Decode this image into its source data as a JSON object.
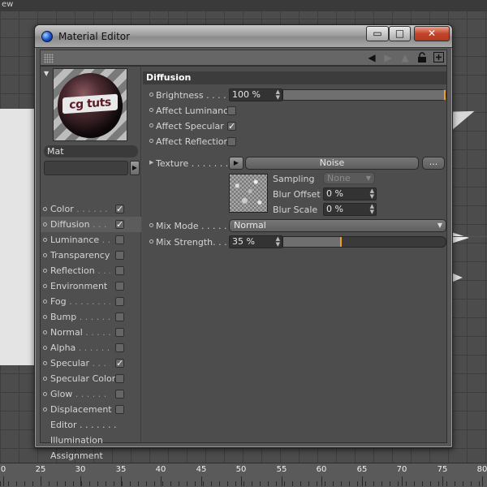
{
  "viewport": {
    "top_text": "ew",
    "ruler_ticks": [
      "0",
      "25",
      "30",
      "35",
      "40",
      "45",
      "50",
      "55",
      "60",
      "65",
      "70",
      "75",
      "80"
    ]
  },
  "window": {
    "title": "Material Editor",
    "buttons": {
      "minimize": "▭",
      "maximize": "□",
      "close": "✕"
    }
  },
  "toolbar": {
    "icons": [
      "grip-icon",
      "arrow-left-icon",
      "arrow-right-icon",
      "arrow-up-icon",
      "lock-icon",
      "new-window-icon"
    ]
  },
  "material": {
    "preview_label": "cg tuts",
    "name": "Mat"
  },
  "channels": [
    {
      "label": "Color",
      "lead": "Color . . . . . . .",
      "checked": true,
      "active": false
    },
    {
      "label": "Diffusion",
      "lead": "Diffusion . . . . .",
      "checked": true,
      "active": true
    },
    {
      "label": "Luminance",
      "lead": "Luminance . . .",
      "checked": false,
      "active": false
    },
    {
      "label": "Transparency",
      "lead": "Transparency",
      "checked": false,
      "active": false
    },
    {
      "label": "Reflection",
      "lead": "Reflection . . . .",
      "checked": false,
      "active": false
    },
    {
      "label": "Environment",
      "lead": "Environment . .",
      "checked": false,
      "active": false
    },
    {
      "label": "Fog",
      "lead": "Fog . . . . . . . . .",
      "checked": false,
      "active": false
    },
    {
      "label": "Bump",
      "lead": "Bump . . . . . . . .",
      "checked": false,
      "active": false
    },
    {
      "label": "Normal",
      "lead": "Normal . . . . . .",
      "checked": false,
      "active": false
    },
    {
      "label": "Alpha",
      "lead": "Alpha . . . . . . .",
      "checked": false,
      "active": false
    },
    {
      "label": "Specular",
      "lead": "Specular . . . . .",
      "checked": true,
      "active": false
    },
    {
      "label": "Specular Color",
      "lead": "Specular Color",
      "checked": false,
      "active": false
    },
    {
      "label": "Glow",
      "lead": "Glow . . . . . . . .",
      "checked": false,
      "active": false
    },
    {
      "label": "Displacement",
      "lead": "Displacement",
      "checked": false,
      "active": false
    }
  ],
  "extra_items": [
    "Editor . . . . . . .",
    "Illumination",
    "Assignment"
  ],
  "diffusion": {
    "title": "Diffusion",
    "brightness": {
      "label": "Brightness . . . . . .",
      "value": "100 %",
      "fraction": 1.0
    },
    "affect_luminance": {
      "label": "Affect Luminance",
      "checked": false
    },
    "affect_specular": {
      "label": "Affect Specular",
      "checked": true
    },
    "affect_reflection": {
      "label": "Affect Reflection",
      "checked": false
    },
    "texture": {
      "label": "Texture . . . . . . . . .",
      "name": "Noise",
      "more": "...",
      "sampling_label": "Sampling",
      "sampling_value": "None",
      "blur_offset_label": "Blur Offset",
      "blur_offset_value": "0 %",
      "blur_scale_label": "Blur Scale",
      "blur_scale_value": "0 %"
    },
    "mix_mode": {
      "label": "Mix Mode . . . . . . .",
      "value": "Normal"
    },
    "mix_strength": {
      "label": "Mix Strength. . . . .",
      "value": "35 %",
      "fraction": 0.35
    }
  },
  "colors": {
    "accent": "#f0a020",
    "close": "#c4442a"
  }
}
